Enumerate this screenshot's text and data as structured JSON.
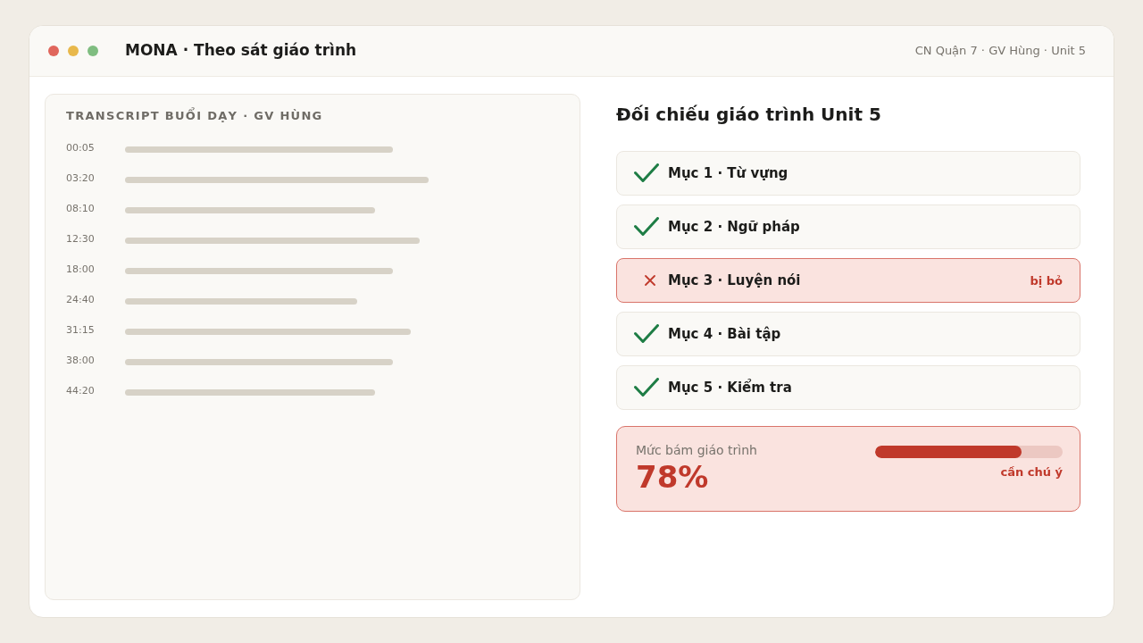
{
  "window": {
    "title": "MONA · Theo sát giáo trình",
    "context": "CN Quận 7 · GV Hùng · Unit 5"
  },
  "transcript": {
    "title": "TRANSCRIPT BUỔI DẠY · GV HÙNG",
    "lines": [
      {
        "time": "00:05"
      },
      {
        "time": "03:20"
      },
      {
        "time": "08:10"
      },
      {
        "time": "12:30"
      },
      {
        "time": "18:00"
      },
      {
        "time": "24:40"
      },
      {
        "time": "31:15"
      },
      {
        "time": "38:00"
      },
      {
        "time": "44:20"
      }
    ]
  },
  "checklist": {
    "title": "Đối chiếu giáo trình Unit 5",
    "items": [
      {
        "label": "Mục 1 · Từ vựng",
        "checked": true
      },
      {
        "label": "Mục 2 · Ngữ pháp",
        "checked": true
      },
      {
        "label": "Mục 3 · Luyện nói",
        "checked": false,
        "note": "bị bỏ"
      },
      {
        "label": "Mục 4 · Bài tập",
        "checked": true
      },
      {
        "label": "Mục 5 · Kiểm tra",
        "checked": true
      }
    ]
  },
  "adherence": {
    "label": "Mức bám giáo trình",
    "value": "78%",
    "level": 0.78,
    "status": "cần chú ý",
    "warning": true
  }
}
